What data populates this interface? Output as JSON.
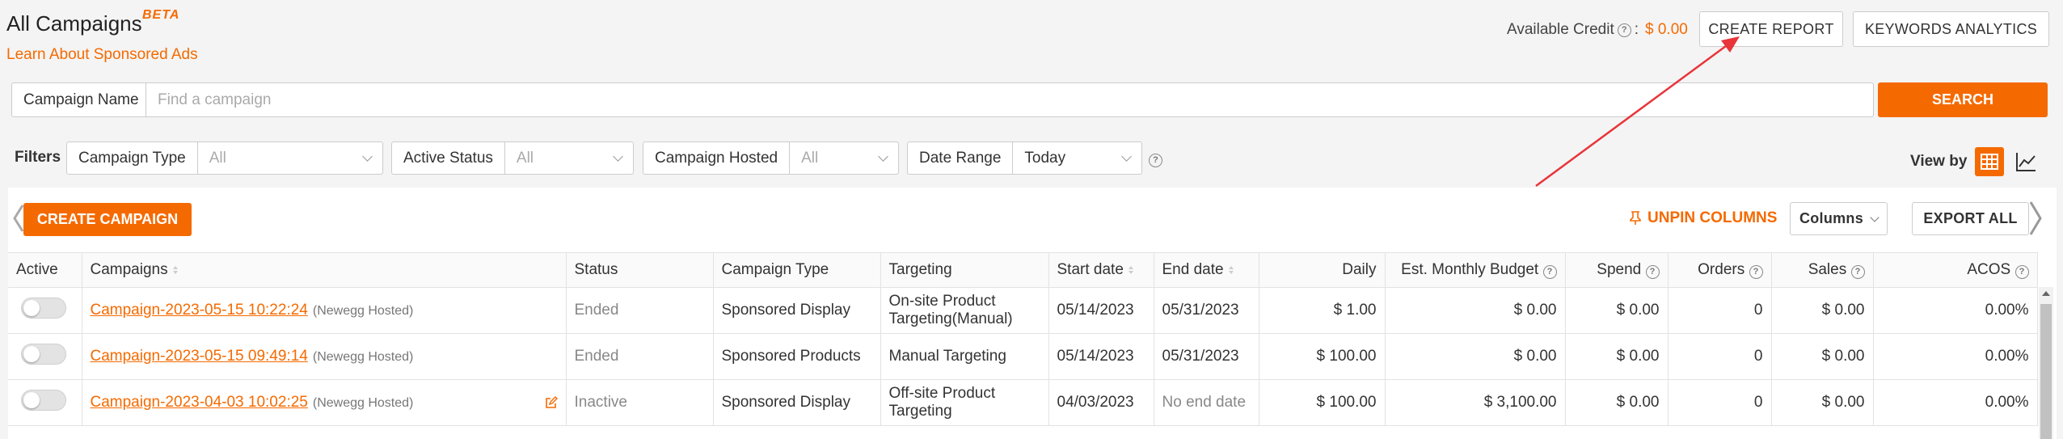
{
  "header": {
    "title": "All Campaigns",
    "beta": "BETA",
    "learn_link": "Learn About Sponsored Ads",
    "credit_label": "Available Credit",
    "credit_sep": ":",
    "credit_amount": "$ 0.00",
    "create_report": "CREATE REPORT",
    "keywords_analytics": "KEYWORDS ANALYTICS"
  },
  "search": {
    "label": "Campaign Name",
    "placeholder": "Find a campaign",
    "button": "SEARCH"
  },
  "filters": {
    "label": "Filters",
    "campaign_type": {
      "label": "Campaign Type",
      "value": "All"
    },
    "active_status": {
      "label": "Active Status",
      "value": "All"
    },
    "campaign_hosted": {
      "label": "Campaign Hosted",
      "value": "All"
    },
    "date_range": {
      "label": "Date Range",
      "value": "Today"
    }
  },
  "view_by": {
    "label": "View by"
  },
  "toolbar": {
    "create_campaign": "CREATE CAMPAIGN",
    "unpin_columns": "UNPIN COLUMNS",
    "columns": "Columns",
    "export_all": "EXPORT ALL"
  },
  "table": {
    "headers": {
      "active": "Active",
      "campaigns": "Campaigns",
      "status": "Status",
      "campaign_type": "Campaign Type",
      "targeting": "Targeting",
      "start_date": "Start date",
      "end_date": "End date",
      "daily": "Daily",
      "est_monthly_budget": "Est. Monthly Budget",
      "spend": "Spend",
      "orders": "Orders",
      "sales": "Sales",
      "acos": "ACOS"
    },
    "rows": [
      {
        "campaign": "Campaign-2023-05-15 10:22:24",
        "hosted": "(Newegg Hosted)",
        "status": "Ended",
        "type": "Sponsored Display",
        "targeting": "On-site Product Targeting(Manual)",
        "start": "05/14/2023",
        "end": "05/31/2023",
        "daily": "$ 1.00",
        "monthly": "$ 0.00",
        "spend": "$ 0.00",
        "orders": "0",
        "sales": "$ 0.00",
        "acos": "0.00%"
      },
      {
        "campaign": "Campaign-2023-05-15 09:49:14",
        "hosted": "(Newegg Hosted)",
        "status": "Ended",
        "type": "Sponsored Products",
        "targeting": "Manual Targeting",
        "start": "05/14/2023",
        "end": "05/31/2023",
        "daily": "$ 100.00",
        "monthly": "$ 0.00",
        "spend": "$ 0.00",
        "orders": "0",
        "sales": "$ 0.00",
        "acos": "0.00%"
      },
      {
        "campaign": "Campaign-2023-04-03 10:02:25",
        "hosted": "(Newegg Hosted)",
        "status": "Inactive",
        "type": "Sponsored Display",
        "targeting": "Off-site Product Targeting",
        "start": "04/03/2023",
        "end": "No end date",
        "daily": "$ 100.00",
        "monthly": "$ 3,100.00",
        "spend": "$ 0.00",
        "orders": "0",
        "sales": "$ 0.00",
        "acos": "0.00%"
      }
    ]
  },
  "colors": {
    "accent": "#f56a00",
    "annotation_arrow": "#e8353a"
  }
}
